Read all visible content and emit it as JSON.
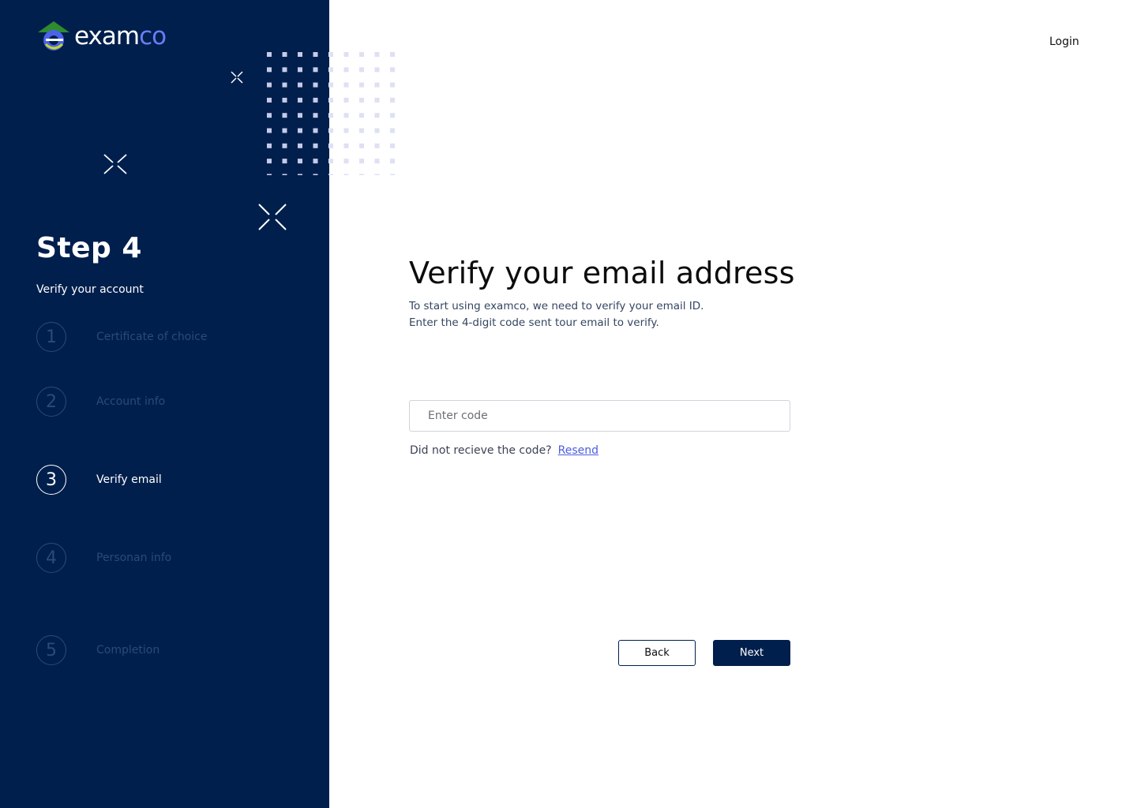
{
  "brand": {
    "name_main": "exam",
    "name_accent": "co",
    "accent_color": "#6a7cf5",
    "sidebar_color": "#001f4d"
  },
  "sidebar": {
    "step_title": "Step 4",
    "step_subtitle": "Verify your account",
    "steps": [
      {
        "number": "1",
        "label": "Certificate of choice",
        "active": false
      },
      {
        "number": "2",
        "label": "Account info",
        "active": false
      },
      {
        "number": "3",
        "label": "Verify email",
        "active": true
      },
      {
        "number": "4",
        "label": "Personan info",
        "active": false
      },
      {
        "number": "5",
        "label": "Completion",
        "active": false
      }
    ]
  },
  "header": {
    "login_label": "Login"
  },
  "main": {
    "title": "Verify your email address",
    "desc_line1": "To start using examco, we need to verify your email ID.",
    "desc_line2": "Enter the 4-digit code sent tour email to verify.",
    "code_placeholder": "Enter code",
    "code_value": "",
    "resend_prompt": "Did not recieve the code?",
    "resend_label": "Resend",
    "back_label": "Back",
    "next_label": "Next"
  }
}
